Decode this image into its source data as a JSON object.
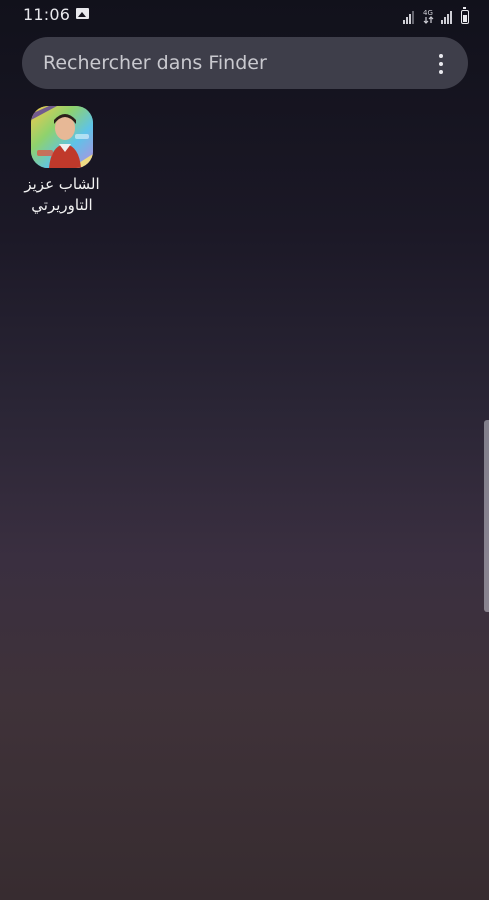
{
  "status_bar": {
    "time": "11:06",
    "icons": [
      "gallery-icon",
      "signal-icon",
      "lte-icon",
      "signal-icon",
      "battery-icon"
    ]
  },
  "search": {
    "placeholder": "Rechercher dans Finder",
    "menu_icon": "more-vertical-icon"
  },
  "apps": [
    {
      "label_line1": "الشاب عزيز",
      "label_line2": "التاوريرتي",
      "icon": "app-icon-portrait"
    }
  ],
  "colors": {
    "search_bg": "#484854",
    "search_text": "#c9c9cf",
    "bg_top": "#11111b",
    "bg_bottom": "#372c30"
  }
}
